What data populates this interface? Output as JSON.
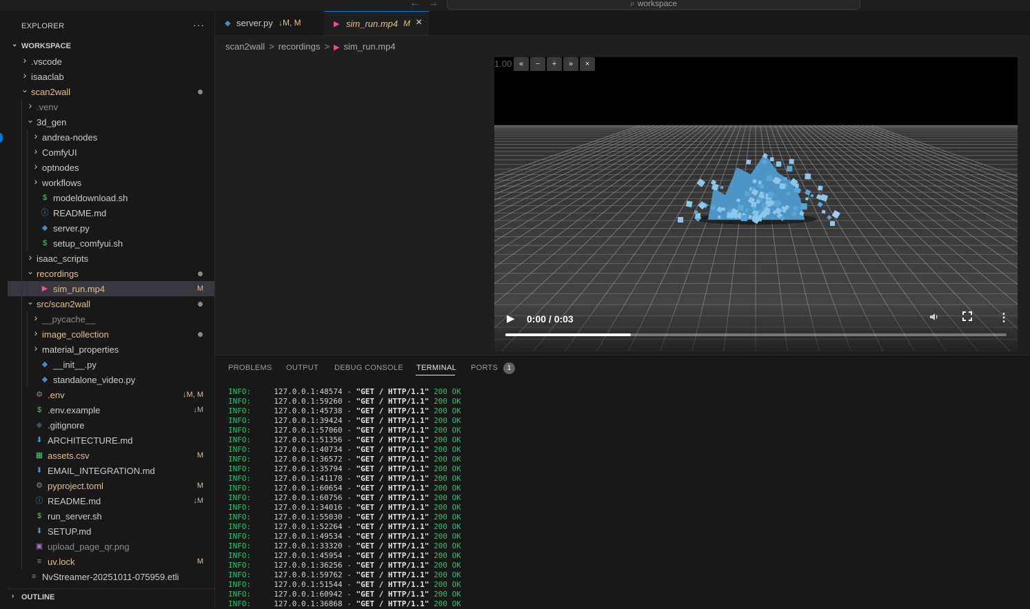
{
  "titlebar": {
    "back_icon": "arrow-left-icon",
    "forward_icon": "arrow-right-icon",
    "search_text": "workspace"
  },
  "sidebar": {
    "title": "EXPLORER",
    "more": "···",
    "workspace_label": "WORKSPACE",
    "tree": [
      {
        "name": ".vscode",
        "kind": "folder",
        "depth": 0,
        "open": false,
        "color": "#cccccc"
      },
      {
        "name": "isaaclab",
        "kind": "folder",
        "depth": 0,
        "open": false,
        "color": "#cccccc"
      },
      {
        "name": "scan2wall",
        "kind": "folder",
        "depth": 0,
        "open": true,
        "color": "#e2c08d",
        "dot": true
      },
      {
        "name": ".venv",
        "kind": "folder",
        "depth": 1,
        "open": false,
        "color": "#8b8b8b"
      },
      {
        "name": "3d_gen",
        "kind": "folder",
        "depth": 1,
        "open": true,
        "color": "#cccccc"
      },
      {
        "name": "andrea-nodes",
        "kind": "folder",
        "depth": 2,
        "open": false,
        "color": "#cccccc"
      },
      {
        "name": "ComfyUI",
        "kind": "folder",
        "depth": 2,
        "open": false,
        "color": "#cccccc"
      },
      {
        "name": "optnodes",
        "kind": "folder",
        "depth": 2,
        "open": false,
        "color": "#cccccc"
      },
      {
        "name": "workflows",
        "kind": "folder",
        "depth": 2,
        "open": false,
        "color": "#cccccc"
      },
      {
        "name": "modeldownload.sh",
        "kind": "file",
        "icon": "$",
        "icon_color": "#4ec96f",
        "depth": 2,
        "color": "#cccccc"
      },
      {
        "name": "README.md",
        "kind": "file",
        "icon": "ⓘ",
        "icon_color": "#519aba",
        "depth": 2,
        "color": "#cccccc"
      },
      {
        "name": "server.py",
        "kind": "file",
        "icon": "◆",
        "icon_color": "#4b8bbe",
        "depth": 2,
        "color": "#cccccc"
      },
      {
        "name": "setup_comfyui.sh",
        "kind": "file",
        "icon": "$",
        "icon_color": "#4ec96f",
        "depth": 2,
        "color": "#cccccc"
      },
      {
        "name": "isaac_scripts",
        "kind": "folder",
        "depth": 1,
        "open": false,
        "color": "#cccccc"
      },
      {
        "name": "recordings",
        "kind": "folder",
        "depth": 1,
        "open": true,
        "color": "#e2c08d",
        "dot": true
      },
      {
        "name": "sim_run.mp4",
        "kind": "file",
        "icon": "▶",
        "icon_color": "#f14c9a",
        "depth": 2,
        "color": "#e2c08d",
        "badge": "M",
        "selected": true
      },
      {
        "name": "src/scan2wall",
        "kind": "folder",
        "depth": 1,
        "open": true,
        "color": "#e2c08d",
        "dot": true
      },
      {
        "name": "__pycache__",
        "kind": "folder",
        "depth": 2,
        "open": false,
        "color": "#8b8b8b"
      },
      {
        "name": "image_collection",
        "kind": "folder",
        "depth": 2,
        "open": false,
        "color": "#e2c08d",
        "dot": true
      },
      {
        "name": "material_properties",
        "kind": "folder",
        "depth": 2,
        "open": false,
        "color": "#cccccc"
      },
      {
        "name": "__init__.py",
        "kind": "file",
        "icon": "◆",
        "icon_color": "#4b8bbe",
        "depth": 2,
        "color": "#cccccc"
      },
      {
        "name": "standalone_video.py",
        "kind": "file",
        "icon": "◆",
        "icon_color": "#4b8bbe",
        "depth": 2,
        "color": "#cccccc"
      },
      {
        "name": ".env",
        "kind": "file",
        "icon": "⚙",
        "icon_color": "#8b8b8b",
        "depth": 1,
        "color": "#e2c08d",
        "badge": "↓M, M"
      },
      {
        "name": ".env.example",
        "kind": "file",
        "icon": "$",
        "icon_color": "#4ec96f",
        "depth": 1,
        "color": "#cccccc",
        "badge": "↓M"
      },
      {
        "name": ".gitignore",
        "kind": "file",
        "icon": "◆",
        "icon_color": "#41535b",
        "depth": 1,
        "color": "#cccccc"
      },
      {
        "name": "ARCHITECTURE.md",
        "kind": "file",
        "icon": "⬇",
        "icon_color": "#519aba",
        "depth": 1,
        "color": "#cccccc"
      },
      {
        "name": "assets.csv",
        "kind": "file",
        "icon": "▦",
        "icon_color": "#4ec96f",
        "depth": 1,
        "color": "#e2c08d",
        "badge": "M"
      },
      {
        "name": "EMAIL_INTEGRATION.md",
        "kind": "file",
        "icon": "⬇",
        "icon_color": "#519aba",
        "depth": 1,
        "color": "#cccccc"
      },
      {
        "name": "pyproject.toml",
        "kind": "file",
        "icon": "⚙",
        "icon_color": "#8b8b8b",
        "depth": 1,
        "color": "#e2c08d",
        "badge": "M"
      },
      {
        "name": "README.md",
        "kind": "file",
        "icon": "ⓘ",
        "icon_color": "#519aba",
        "depth": 1,
        "color": "#cccccc",
        "badge": "↓M"
      },
      {
        "name": "run_server.sh",
        "kind": "file",
        "icon": "$",
        "icon_color": "#4ec96f",
        "depth": 1,
        "color": "#cccccc"
      },
      {
        "name": "SETUP.md",
        "kind": "file",
        "icon": "⬇",
        "icon_color": "#519aba",
        "depth": 1,
        "color": "#cccccc"
      },
      {
        "name": "upload_page_qr.png",
        "kind": "file",
        "icon": "▣",
        "icon_color": "#a074c4",
        "depth": 1,
        "color": "#8b8b8b"
      },
      {
        "name": "uv.lock",
        "kind": "file",
        "icon": "≡",
        "icon_color": "#8b8b8b",
        "depth": 1,
        "color": "#e2c08d",
        "badge": "M"
      },
      {
        "name": "NvStreamer-20251011-075959.etli",
        "kind": "file",
        "icon": "≡",
        "icon_color": "#8b8b8b",
        "depth": 0,
        "color": "#cccccc"
      }
    ],
    "outline_label": "OUTLINE"
  },
  "tabs": [
    {
      "name": "server.py",
      "status": "↓M, M",
      "icon": "◆",
      "icon_color": "#4b8bbe",
      "active": false
    },
    {
      "name": "sim_run.mp4",
      "status": "M",
      "icon": "▶",
      "icon_color": "#f14c9a",
      "active": true,
      "close": "×"
    }
  ],
  "breadcrumb": {
    "items": [
      "scan2wall",
      "recordings",
      "sim_run.mp4"
    ],
    "sep": ">",
    "file_icon": "▶"
  },
  "video": {
    "speed": "1.00",
    "speed_buttons": [
      "«",
      "−",
      "+",
      "»",
      "×"
    ],
    "time": "0:00 / 0:03",
    "play_icon": "▶",
    "volume_icon": "speaker-icon",
    "fullscreen_icon": "fullscreen-icon",
    "more_icon": "⋮",
    "progress_fraction": 0.25
  },
  "panel": {
    "tabs": [
      "PROBLEMS",
      "OUTPUT",
      "DEBUG CONSOLE",
      "TERMINAL",
      "PORTS"
    ],
    "active_tab": "TERMINAL",
    "ports_count": "1"
  },
  "terminal": {
    "lines": [
      {
        "level": "INFO:",
        "addr": "127.0.0.1:48574",
        "req": "\"GET / HTTP/1.1\"",
        "code": "200 OK"
      },
      {
        "level": "INFO:",
        "addr": "127.0.0.1:59260",
        "req": "\"GET / HTTP/1.1\"",
        "code": "200 OK"
      },
      {
        "level": "INFO:",
        "addr": "127.0.0.1:45738",
        "req": "\"GET / HTTP/1.1\"",
        "code": "200 OK"
      },
      {
        "level": "INFO:",
        "addr": "127.0.0.1:39424",
        "req": "\"GET / HTTP/1.1\"",
        "code": "200 OK"
      },
      {
        "level": "INFO:",
        "addr": "127.0.0.1:57060",
        "req": "\"GET / HTTP/1.1\"",
        "code": "200 OK"
      },
      {
        "level": "INFO:",
        "addr": "127.0.0.1:51356",
        "req": "\"GET / HTTP/1.1\"",
        "code": "200 OK"
      },
      {
        "level": "INFO:",
        "addr": "127.0.0.1:40734",
        "req": "\"GET / HTTP/1.1\"",
        "code": "200 OK"
      },
      {
        "level": "INFO:",
        "addr": "127.0.0.1:36572",
        "req": "\"GET / HTTP/1.1\"",
        "code": "200 OK"
      },
      {
        "level": "INFO:",
        "addr": "127.0.0.1:35794",
        "req": "\"GET / HTTP/1.1\"",
        "code": "200 OK"
      },
      {
        "level": "INFO:",
        "addr": "127.0.0.1:41178",
        "req": "\"GET / HTTP/1.1\"",
        "code": "200 OK"
      },
      {
        "level": "INFO:",
        "addr": "127.0.0.1:60654",
        "req": "\"GET / HTTP/1.1\"",
        "code": "200 OK"
      },
      {
        "level": "INFO:",
        "addr": "127.0.0.1:60756",
        "req": "\"GET / HTTP/1.1\"",
        "code": "200 OK"
      },
      {
        "level": "INFO:",
        "addr": "127.0.0.1:34016",
        "req": "\"GET / HTTP/1.1\"",
        "code": "200 OK"
      },
      {
        "level": "INFO:",
        "addr": "127.0.0.1:55030",
        "req": "\"GET / HTTP/1.1\"",
        "code": "200 OK"
      },
      {
        "level": "INFO:",
        "addr": "127.0.0.1:52264",
        "req": "\"GET / HTTP/1.1\"",
        "code": "200 OK"
      },
      {
        "level": "INFO:",
        "addr": "127.0.0.1:49534",
        "req": "\"GET / HTTP/1.1\"",
        "code": "200 OK"
      },
      {
        "level": "INFO:",
        "addr": "127.0.0.1:33320",
        "req": "\"GET / HTTP/1.1\"",
        "code": "200 OK"
      },
      {
        "level": "INFO:",
        "addr": "127.0.0.1:45954",
        "req": "\"GET / HTTP/1.1\"",
        "code": "200 OK"
      },
      {
        "level": "INFO:",
        "addr": "127.0.0.1:36256",
        "req": "\"GET / HTTP/1.1\"",
        "code": "200 OK"
      },
      {
        "level": "INFO:",
        "addr": "127.0.0.1:59762",
        "req": "\"GET / HTTP/1.1\"",
        "code": "200 OK"
      },
      {
        "level": "INFO:",
        "addr": "127.0.0.1:51544",
        "req": "\"GET / HTTP/1.1\"",
        "code": "200 OK"
      },
      {
        "level": "INFO:",
        "addr": "127.0.0.1:60942",
        "req": "\"GET / HTTP/1.1\"",
        "code": "200 OK"
      },
      {
        "level": "INFO:",
        "addr": "127.0.0.1:36868",
        "req": "\"GET / HTTP/1.1\"",
        "code": "200 OK"
      }
    ]
  },
  "colors": {
    "accent": "#0078d4",
    "modified": "#e2c08d",
    "info": "#2fbf71",
    "cube": "#5aa6d6"
  }
}
